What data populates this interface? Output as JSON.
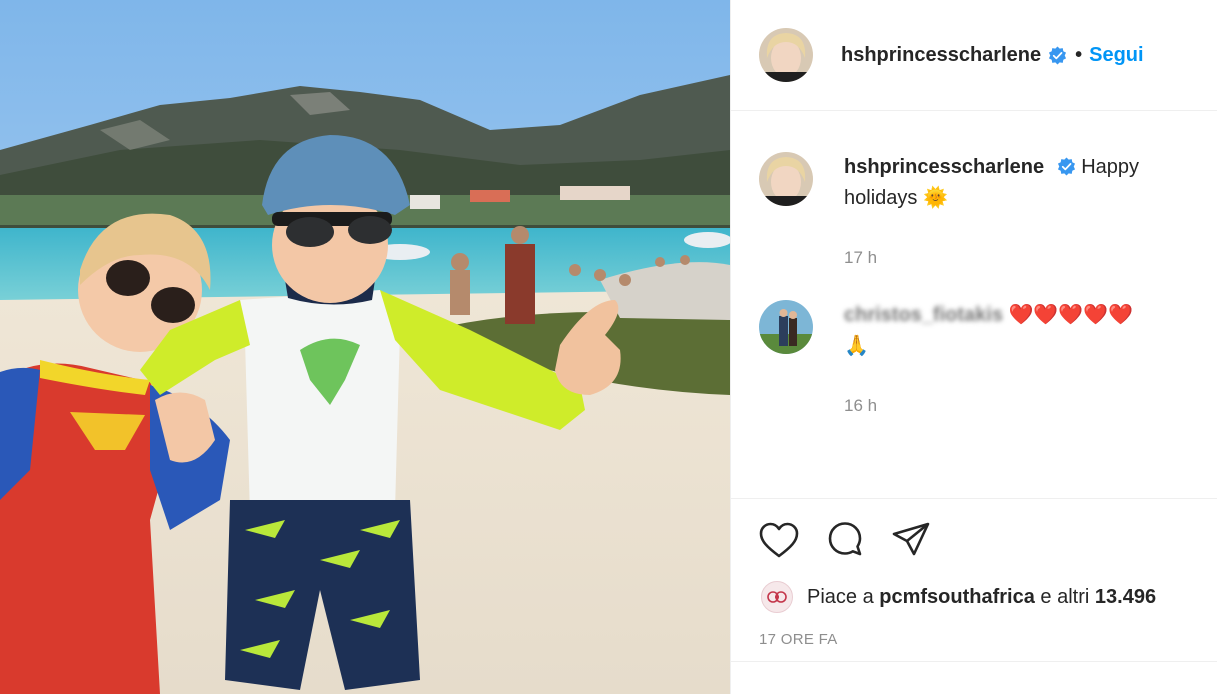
{
  "post": {
    "username": "hshprincesscharlene",
    "follow_label": "Segui",
    "dot": "•"
  },
  "comments": [
    {
      "username": "hshprincesscharlene",
      "text": "Happy holidays",
      "emoji": "🌞",
      "time": "17 h"
    },
    {
      "username": "christos_fiotakis",
      "text": "❤️❤️❤️❤️❤️",
      "emoji": "🙏",
      "time": "16 h"
    }
  ],
  "likes": {
    "prefix": "Piace a ",
    "user": "pcmfsouthafrica",
    "suffix": " e altri ",
    "count": "13.496"
  },
  "posted_ago": "17 ORE FA",
  "icons": [
    "heart-icon",
    "comment-icon",
    "share-icon"
  ],
  "colors": {
    "accent": "#0095f6",
    "verified": "#3897f0",
    "muted": "#8e8e8e",
    "text": "#262626"
  }
}
